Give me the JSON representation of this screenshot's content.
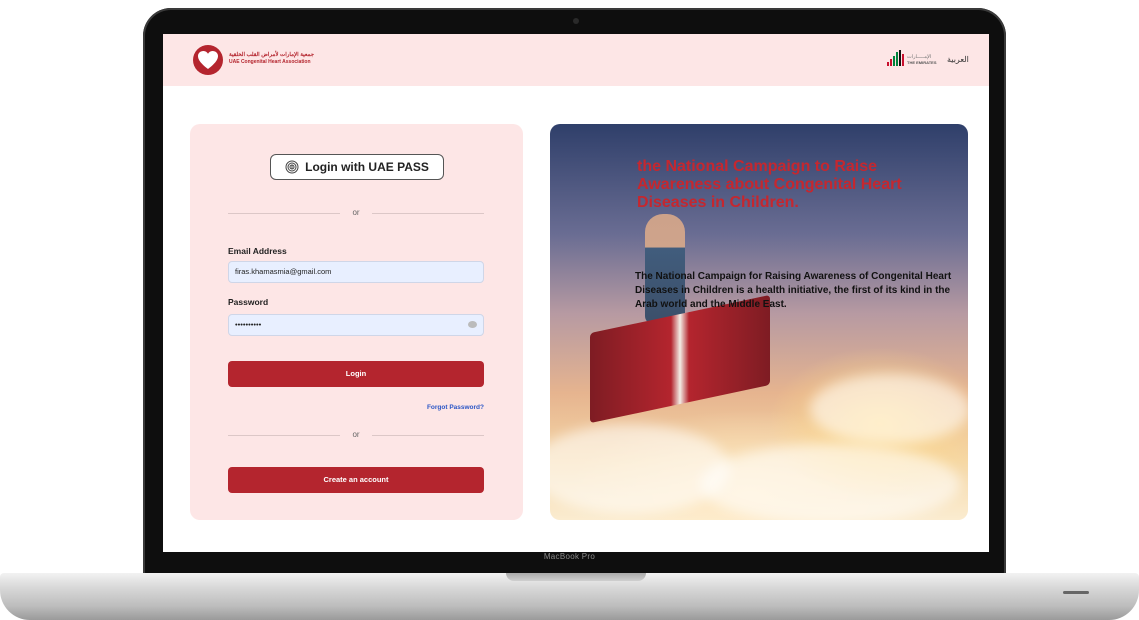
{
  "device": {
    "bezel_label": "MacBook Pro"
  },
  "header": {
    "logo_arabic": "جمعية الإمارات لأمراض القلب الخلقية",
    "logo_english": "UAE Congenital Heart Association",
    "emirates_arabic": "الإمـــــارات",
    "emirates_english": "THE EMIRATES",
    "language_toggle": "العربية"
  },
  "login": {
    "uae_pass_label": "Login with UAE PASS",
    "or_label_1": "or",
    "email_label": "Email Address",
    "email_value": "firas.khamasmia@gmail.com",
    "password_label": "Password",
    "password_value": "••••••••••",
    "login_button": "Login",
    "forgot_password": "Forgot Password?",
    "or_label_2": "or",
    "create_account_button": "Create an account"
  },
  "hero": {
    "title": "the National Campaign to Raise Awareness about Congenital Heart Diseases in Children.",
    "body": "The National Campaign for Raising Awareness of Congenital Heart Diseases in Children is a health initiative, the first of its kind in the Arab world and the Middle East."
  },
  "colors": {
    "brand_red": "#b4252e",
    "header_bg": "#fde6e6",
    "card_bg": "#fde6e6",
    "input_bg": "#e8efff",
    "link_blue": "#2a56c6"
  }
}
